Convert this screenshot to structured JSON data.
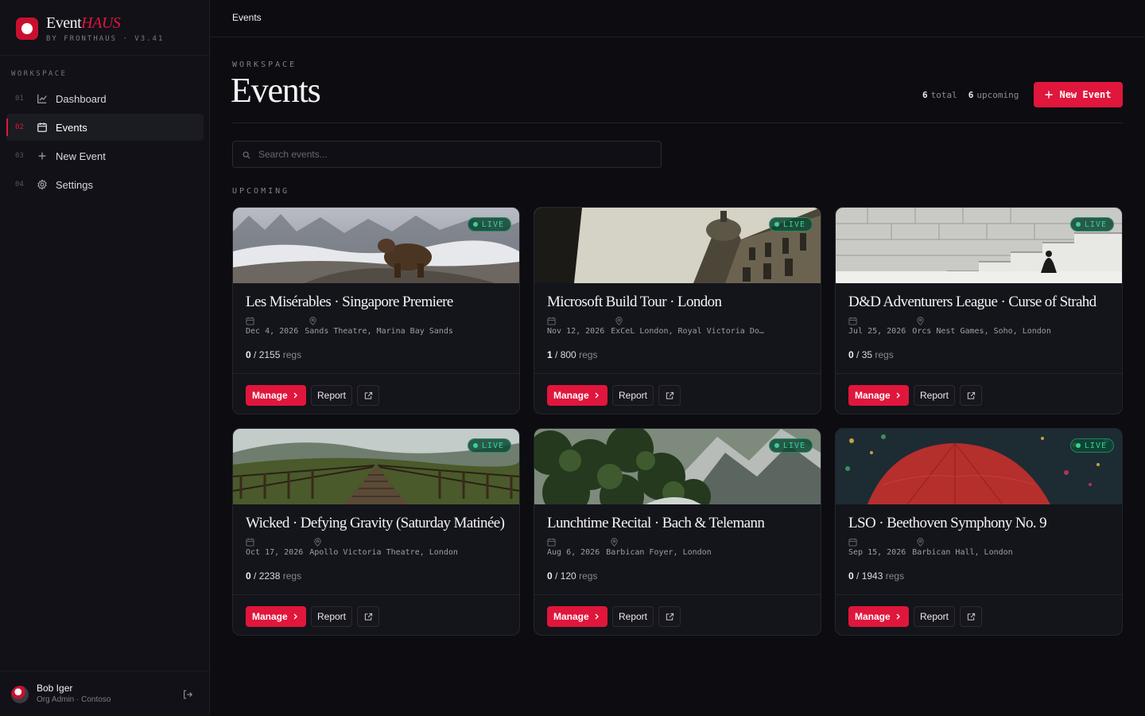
{
  "app": {
    "name_main": "Event",
    "name_accent": "HAUS",
    "subtitle": "BY FRONTHAUS · V3.41"
  },
  "sidebar": {
    "section_label": "WORKSPACE",
    "items": [
      {
        "num": "01",
        "label": "Dashboard",
        "icon": "chart-line-icon"
      },
      {
        "num": "02",
        "label": "Events",
        "icon": "calendar-icon",
        "active": true
      },
      {
        "num": "03",
        "label": "New Event",
        "icon": "plus-icon"
      },
      {
        "num": "04",
        "label": "Settings",
        "icon": "gear-icon"
      }
    ],
    "user": {
      "name": "Bob Iger",
      "role": "Org Admin · Contoso"
    }
  },
  "topbar": {
    "breadcrumb": "Events"
  },
  "header": {
    "eyebrow": "WORKSPACE",
    "title": "Events",
    "total_count": "6",
    "total_label": "total",
    "upcoming_count": "6",
    "upcoming_label": "upcoming",
    "new_button": "New Event"
  },
  "search": {
    "placeholder": "Search events..."
  },
  "group_label": "UPCOMING",
  "colors": {
    "accent": "#e0163c",
    "live": "#34d399",
    "background": "#0c0c11"
  },
  "events": [
    {
      "title": "Les Misérables · Singapore Premiere",
      "date": "Dec 4, 2026",
      "venue": "Sands Theatre, Marina Bay Sands",
      "registered": "0",
      "capacity": "/ 2155",
      "regs_label": "regs",
      "status": "LIVE",
      "image": "bear-on-snowy-hill"
    },
    {
      "title": "Microsoft Build Tour · London",
      "date": "Nov 12, 2026",
      "venue": "ExCeL London, Royal Victoria Do…",
      "registered": "1",
      "capacity": "/ 800",
      "regs_label": "regs",
      "status": "LIVE",
      "image": "ornate-building-dome"
    },
    {
      "title": "D&D Adventurers League · Curse of Strahd",
      "date": "Jul 25, 2026",
      "venue": "Orcs Nest Games, Soho, London",
      "registered": "0",
      "capacity": "/ 35",
      "regs_label": "regs",
      "status": "LIVE",
      "image": "stone-stairs-figure"
    },
    {
      "title": "Wicked · Defying Gravity (Saturday Matinée)",
      "date": "Oct 17, 2026",
      "venue": "Apollo Victoria Theatre, London",
      "registered": "0",
      "capacity": "/ 2238",
      "regs_label": "regs",
      "status": "LIVE",
      "image": "railway-bridge"
    },
    {
      "title": "Lunchtime Recital · Bach & Telemann",
      "date": "Aug 6, 2026",
      "venue": "Barbican Foyer, London",
      "registered": "0",
      "capacity": "/ 120",
      "regs_label": "regs",
      "status": "LIVE",
      "image": "forest-mountain"
    },
    {
      "title": "LSO · Beethoven Symphony No. 9",
      "date": "Sep 15, 2026",
      "venue": "Barbican Hall, London",
      "registered": "0",
      "capacity": "/ 1943",
      "regs_label": "regs",
      "status": "LIVE",
      "image": "red-umbrella-rain"
    }
  ],
  "card_actions": {
    "manage": "Manage",
    "report": "Report"
  }
}
